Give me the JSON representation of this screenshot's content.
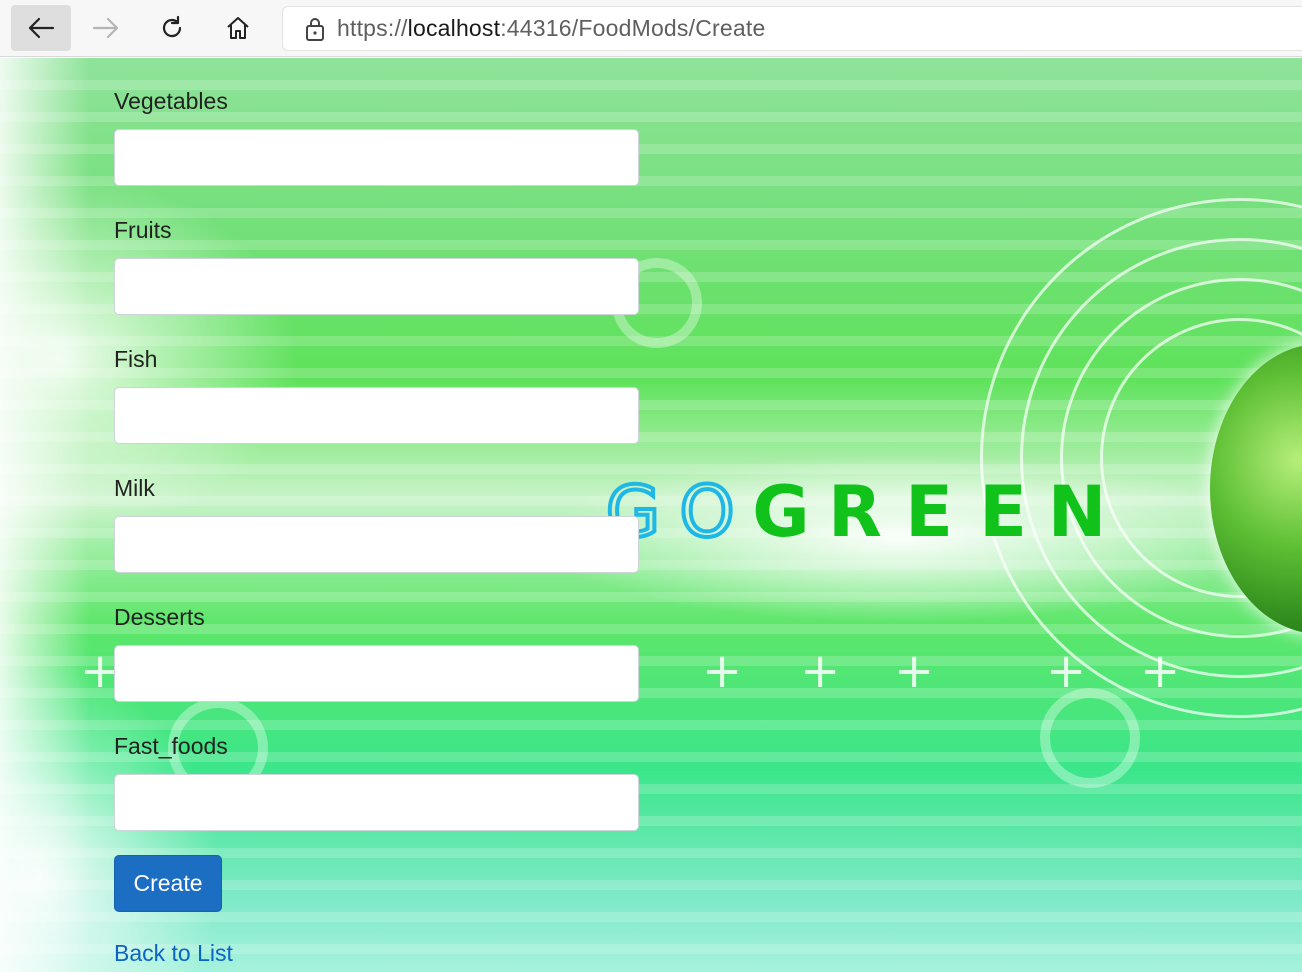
{
  "browser": {
    "url_scheme": "https://",
    "url_host": "localhost",
    "url_rest": ":44316/FoodMods/Create"
  },
  "background": {
    "banner_go": [
      "G",
      "O"
    ],
    "banner_green": [
      "G",
      "R",
      "E",
      "E",
      "N"
    ]
  },
  "form": {
    "fields": [
      {
        "label": "Vegetables",
        "value": ""
      },
      {
        "label": "Fruits",
        "value": ""
      },
      {
        "label": "Fish",
        "value": ""
      },
      {
        "label": "Milk",
        "value": ""
      },
      {
        "label": "Desserts",
        "value": ""
      },
      {
        "label": "Fast_foods",
        "value": ""
      }
    ],
    "submit_label": "Create",
    "back_link_label": "Back to List"
  },
  "colors": {
    "primary_button": "#1b6ec2",
    "link": "#0b63c4",
    "go_text": "#1fb8e6",
    "green_text": "#10c21a"
  }
}
